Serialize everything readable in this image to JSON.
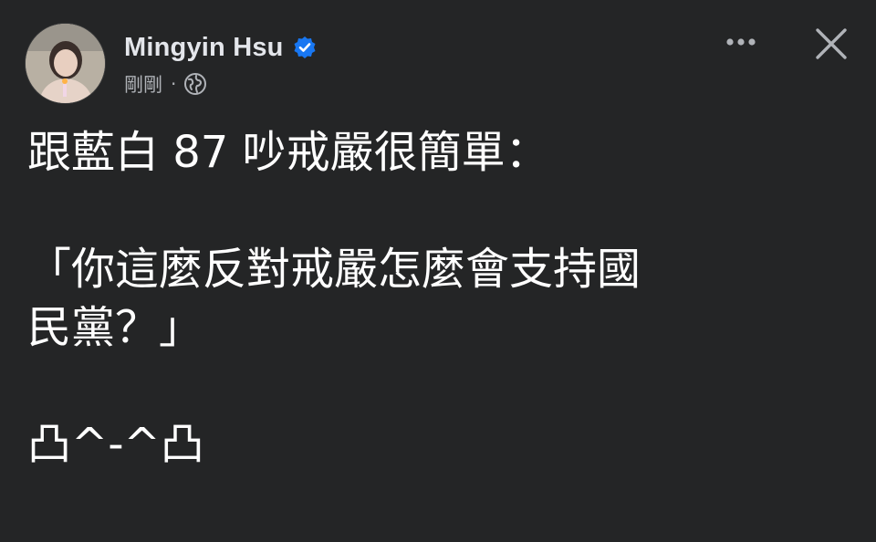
{
  "post": {
    "author": "Mingyin Hsu",
    "verified": true,
    "timestamp": "剛剛",
    "separator": "·",
    "audience_icon": "globe-icon",
    "more_icon": "more-options-icon",
    "close_icon": "close-icon",
    "body_lines": [
      "跟藍白 87 吵戒嚴很簡單：",
      "",
      "「你這麼反對戒嚴怎麼會支持國",
      "民黨？」",
      "",
      "凸^-^凸"
    ]
  },
  "colors": {
    "background": "#242526",
    "text": "#ffffff",
    "secondary_text": "#b0b3b8",
    "verified_blue": "#1877f2"
  }
}
